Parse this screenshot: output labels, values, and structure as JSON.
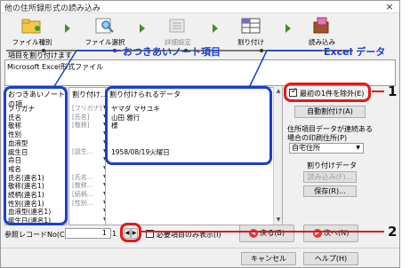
{
  "window": {
    "title": "他の住所録形式の読み込み",
    "close_icon": "×"
  },
  "wizard": {
    "steps": [
      {
        "label": "ファイル種別",
        "icon": "folder-icon",
        "state": "normal"
      },
      {
        "label": "ファイル選択",
        "icon": "search-icon",
        "state": "normal"
      },
      {
        "label": "詳細設定",
        "icon": "settings-icon",
        "state": "disabled"
      },
      {
        "label": "割り付け",
        "icon": "grid-icon",
        "state": "active"
      },
      {
        "label": "読み込み",
        "icon": "import-icon",
        "state": "normal"
      }
    ]
  },
  "section_title": "項目を割り付けます",
  "callouts": {
    "notebook_fields": "おつきあいノート項目",
    "excel_data": "Excel データ",
    "marker1": "1",
    "marker2": "2"
  },
  "file": {
    "type": "Microsoft Excel形式ファイル"
  },
  "columns": {
    "left_header": "おつきあいノートの項",
    "mid_header": "割り付け…",
    "right_header": "割り付けられるデータ"
  },
  "fields": [
    "フリガナ",
    "氏名",
    "敬称",
    "性別",
    "血液型",
    "誕生日",
    "命日",
    "戒名",
    "氏名(連名1)",
    "敬称(連名1)",
    "続柄(連名1)",
    "性別(連名1)",
    "血液型(連名1)",
    "誕生日(連名1)"
  ],
  "assignments": [
    "[フリガナ]",
    "[氏名]",
    "[敬称]",
    "",
    "",
    "[誕生...",
    "",
    "",
    "[氏名...",
    "[敬称...",
    "[続柄...",
    "[性別...",
    "",
    ""
  ],
  "data_values": [
    "ヤマダ マサユキ",
    "山田 雅行",
    "様",
    "",
    "",
    "1958/08/19火曜日",
    "",
    "",
    "",
    "",
    "",
    "",
    "",
    ""
  ],
  "options": {
    "skip_first_row": {
      "label": "最初の1件を除外(E)",
      "checked": true
    },
    "auto_assign": "自動割付け(A)",
    "unassigned_label": "住所項目データが連続ある場合の印刷住所(P)",
    "address_select": "自宅住所",
    "assign_data_label": "割り付けデータ",
    "load": "読み込み(F)...",
    "save": "保存(R)..."
  },
  "record": {
    "label": "参照レコードNo(C)",
    "value": "1",
    "total": "1",
    "prev_icon": "◀",
    "next_icon": "▶",
    "show_required": "必要項目のみ表示(I)"
  },
  "nav": {
    "back": "戻る(B)",
    "next": "次へ(N)",
    "back_icon": "◀",
    "next_icon": "▶"
  },
  "footer": {
    "cancel": "キャンセル",
    "help": "ヘルプ(H)"
  }
}
